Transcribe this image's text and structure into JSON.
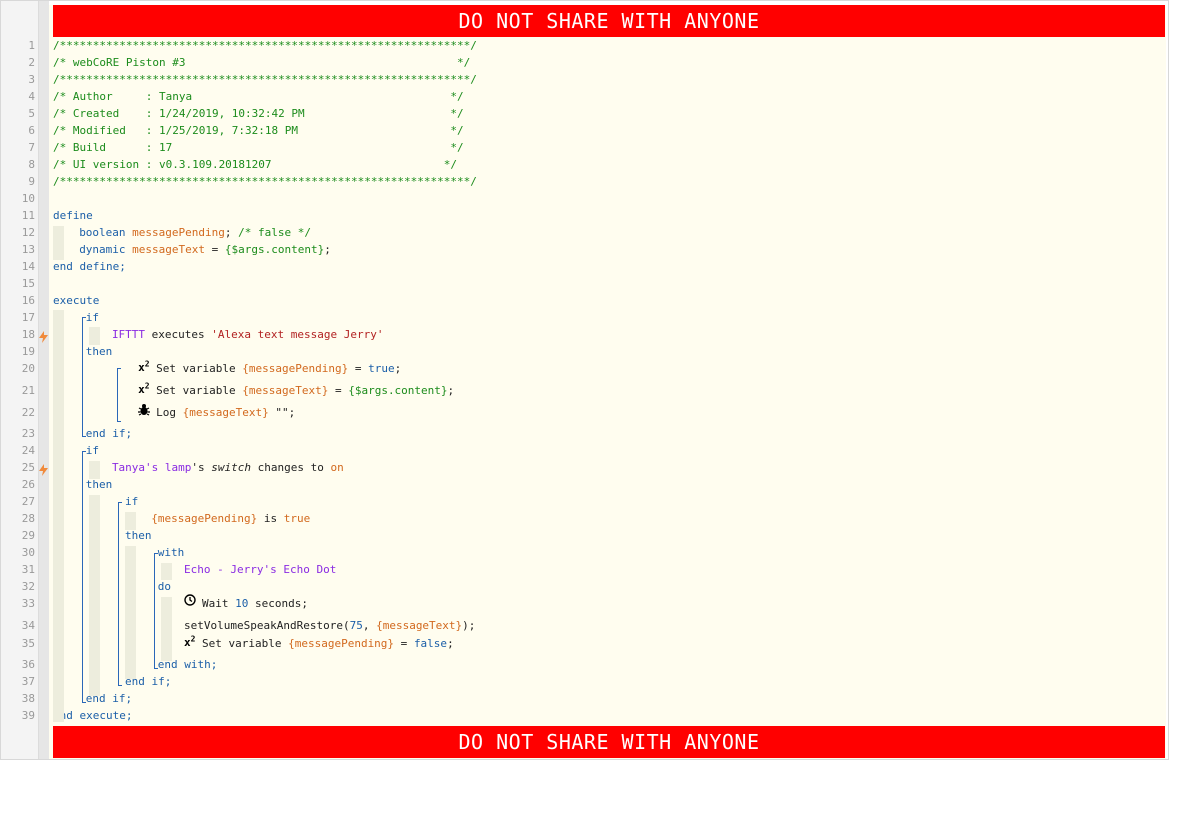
{
  "banner": {
    "text": "DO NOT SHARE WITH ANYONE"
  },
  "lines": [
    {
      "n": "1",
      "parts": [
        {
          "c": "c",
          "t": "/**************************************************************/"
        }
      ]
    },
    {
      "n": "2",
      "parts": [
        {
          "c": "c",
          "t": "/* webCoRE Piston #3                                         */"
        }
      ]
    },
    {
      "n": "3",
      "parts": [
        {
          "c": "c",
          "t": "/**************************************************************/"
        }
      ]
    },
    {
      "n": "4",
      "parts": [
        {
          "c": "c",
          "t": "/* Author     : Tanya                                       */"
        }
      ]
    },
    {
      "n": "5",
      "parts": [
        {
          "c": "c",
          "t": "/* Created    : 1/24/2019, 10:32:42 PM                      */"
        }
      ]
    },
    {
      "n": "6",
      "parts": [
        {
          "c": "c",
          "t": "/* Modified   : 1/25/2019, 7:32:18 PM                       */"
        }
      ]
    },
    {
      "n": "7",
      "parts": [
        {
          "c": "c",
          "t": "/* Build      : 17                                          */"
        }
      ]
    },
    {
      "n": "8",
      "parts": [
        {
          "c": "c",
          "t": "/* UI version : v0.3.109.20181207                          */"
        }
      ]
    },
    {
      "n": "9",
      "parts": [
        {
          "c": "c",
          "t": "/**************************************************************/"
        }
      ]
    },
    {
      "n": "10",
      "parts": []
    },
    {
      "n": "11",
      "parts": [
        {
          "c": "kw",
          "t": "define"
        }
      ]
    },
    {
      "n": "12",
      "parts": [
        {
          "c": "kw",
          "t": "boolean "
        },
        {
          "c": "var",
          "t": "messagePending"
        },
        {
          "c": "",
          "t": "; "
        },
        {
          "c": "c",
          "t": "/* false */"
        }
      ]
    },
    {
      "n": "13",
      "parts": [
        {
          "c": "kw",
          "t": "dynamic "
        },
        {
          "c": "var",
          "t": "messageText"
        },
        {
          "c": "",
          "t": " = "
        },
        {
          "c": "c",
          "t": "{$args.content}"
        },
        {
          "c": "",
          "t": ";"
        }
      ]
    },
    {
      "n": "14",
      "parts": [
        {
          "c": "kw",
          "t": "end define;"
        }
      ]
    },
    {
      "n": "15",
      "parts": []
    },
    {
      "n": "16",
      "parts": [
        {
          "c": "kw",
          "t": "execute"
        }
      ]
    },
    {
      "n": "17",
      "parts": [
        {
          "c": "kw",
          "t": "if"
        }
      ]
    },
    {
      "n": "18",
      "parts": [
        {
          "c": "dev",
          "t": "IFTTT"
        },
        {
          "c": "",
          "t": " executes "
        },
        {
          "c": "str",
          "t": "'Alexa text message Jerry'"
        }
      ]
    },
    {
      "n": "19",
      "parts": [
        {
          "c": "kw",
          "t": "then"
        }
      ]
    },
    {
      "n": "20",
      "parts": [
        {
          "c": "",
          "t": "Set variable "
        },
        {
          "c": "var",
          "t": "{messagePending}"
        },
        {
          "c": "",
          "t": " = "
        },
        {
          "c": "kw",
          "t": "true"
        },
        {
          "c": "",
          "t": ";"
        }
      ]
    },
    {
      "n": "21",
      "parts": [
        {
          "c": "",
          "t": "Set variable "
        },
        {
          "c": "var",
          "t": "{messageText}"
        },
        {
          "c": "",
          "t": " = "
        },
        {
          "c": "c",
          "t": "{$args.content}"
        },
        {
          "c": "",
          "t": ";"
        }
      ]
    },
    {
      "n": "22",
      "parts": [
        {
          "c": "",
          "t": "Log "
        },
        {
          "c": "var",
          "t": "{messageText}"
        },
        {
          "c": "",
          "t": " \"\";"
        }
      ]
    },
    {
      "n": "23",
      "parts": [
        {
          "c": "kw",
          "t": "end if;"
        }
      ]
    },
    {
      "n": "24",
      "parts": [
        {
          "c": "kw",
          "t": "if"
        }
      ]
    },
    {
      "n": "25",
      "parts": [
        {
          "c": "dev",
          "t": "Tanya's lamp"
        },
        {
          "c": "",
          "t": "'s "
        },
        {
          "c": "it",
          "t": "switch"
        },
        {
          "c": "",
          "t": " changes to "
        },
        {
          "c": "var",
          "t": "on"
        }
      ]
    },
    {
      "n": "26",
      "parts": [
        {
          "c": "kw",
          "t": "then"
        }
      ]
    },
    {
      "n": "27",
      "parts": [
        {
          "c": "kw",
          "t": "if"
        }
      ]
    },
    {
      "n": "28",
      "parts": [
        {
          "c": "var",
          "t": "{messagePending}"
        },
        {
          "c": "",
          "t": " is "
        },
        {
          "c": "var",
          "t": "true"
        }
      ]
    },
    {
      "n": "29",
      "parts": [
        {
          "c": "kw",
          "t": "then"
        }
      ]
    },
    {
      "n": "30",
      "parts": [
        {
          "c": "kw",
          "t": "with"
        }
      ]
    },
    {
      "n": "31",
      "parts": [
        {
          "c": "dev",
          "t": "Echo - Jerry's Echo Dot"
        }
      ]
    },
    {
      "n": "32",
      "parts": [
        {
          "c": "kw",
          "t": "do"
        }
      ]
    },
    {
      "n": "33",
      "parts": [
        {
          "c": "",
          "t": "Wait "
        },
        {
          "c": "num",
          "t": "10"
        },
        {
          "c": "",
          "t": " seconds;"
        }
      ]
    },
    {
      "n": "34",
      "parts": [
        {
          "c": "",
          "t": "setVolumeSpeakAndRestore("
        },
        {
          "c": "num",
          "t": "75"
        },
        {
          "c": "",
          "t": ", "
        },
        {
          "c": "var",
          "t": "{messageText}"
        },
        {
          "c": "",
          "t": ");"
        }
      ]
    },
    {
      "n": "35",
      "parts": [
        {
          "c": "",
          "t": "Set variable "
        },
        {
          "c": "var",
          "t": "{messagePending}"
        },
        {
          "c": "",
          "t": " = "
        },
        {
          "c": "kw",
          "t": "false"
        },
        {
          "c": "",
          "t": ";"
        }
      ]
    },
    {
      "n": "36",
      "parts": [
        {
          "c": "kw",
          "t": "end with;"
        }
      ]
    },
    {
      "n": "37",
      "parts": [
        {
          "c": "kw",
          "t": "end if;"
        }
      ]
    },
    {
      "n": "38",
      "parts": [
        {
          "c": "kw",
          "t": "end if;"
        }
      ]
    },
    {
      "n": "39",
      "parts": [
        {
          "c": "kw",
          "t": "end execute;"
        }
      ]
    }
  ],
  "icons": {
    "20": "x2",
    "21": "x2",
    "22": "bug",
    "33": "clock",
    "35": "x2"
  },
  "trigger_lines": [
    "18",
    "25"
  ]
}
